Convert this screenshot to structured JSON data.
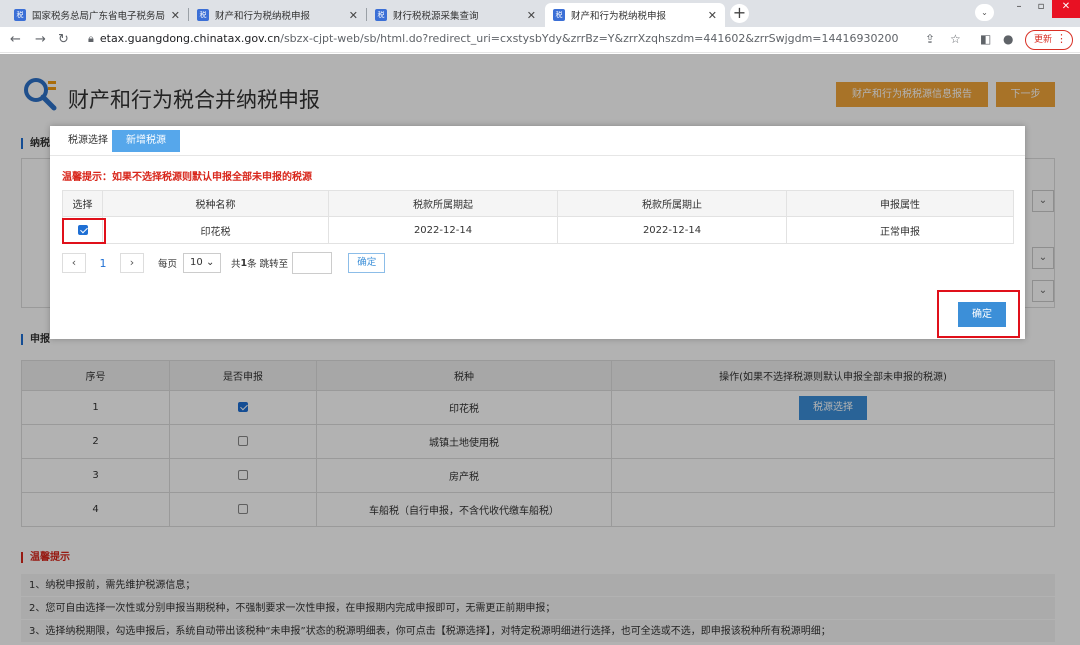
{
  "browser": {
    "tabs": [
      {
        "label": "国家税务总局广东省电子税务局",
        "favicon": "税"
      },
      {
        "label": "财产和行为税纳税申报",
        "favicon": "税"
      },
      {
        "label": "财行税税源采集查询",
        "favicon": "税"
      },
      {
        "label": "财产和行为税纳税申报",
        "favicon": "税"
      }
    ],
    "url_host": "etax.guangdong.chinatax.gov.cn",
    "url_path": "/sbzx-cjpt-web/sb/html.do?redirect_uri=cxstysbYdy&zrrBz=Y&zrrXzqhszdm=441602&zrrSwjgdm=14416930200",
    "update_label": "更新"
  },
  "page": {
    "title": "财产和行为税合并纳税申报",
    "report_button": "财产和行为税税源信息报告",
    "next_button": "下一步",
    "section_taxpayer": "纳税",
    "section_declare": "申报",
    "declare_table": {
      "headers": [
        "序号",
        "是否申报",
        "税种",
        "操作(如果不选择税源则默认申报全部未申报的税源)"
      ],
      "rows": [
        {
          "no": "1",
          "checked": true,
          "tax": "印花税",
          "action": "税源选择"
        },
        {
          "no": "2",
          "checked": false,
          "tax": "城镇土地使用税",
          "action": ""
        },
        {
          "no": "3",
          "checked": false,
          "tax": "房产税",
          "action": ""
        },
        {
          "no": "4",
          "checked": false,
          "tax": "车船税（自行申报，不含代收代缴车船税）",
          "action": ""
        }
      ]
    },
    "tips_title": "温馨提示",
    "tips": [
      "1、纳税申报前，需先维护税源信息；",
      "2、您可自由选择一次性或分别申报当期税种，不强制要求一次性申报，在申报期内完成申报即可，无需更正前期申报；",
      "3、选择纳税期限，勾选申报后，系统自动带出该税种“未申报”状态的税源明细表，你可点击【税源选择】，对特定税源明细进行选择，也可全选或不选，即申报该税种所有税源明细；"
    ]
  },
  "modal": {
    "tab_selected": "税源选择",
    "tab_new": "新增税源",
    "tip": "温馨提示：如果不选择税源则默认申报全部未申报的税源",
    "headers": [
      "选择",
      "税种名称",
      "税款所属期起",
      "税款所属期止",
      "申报属性"
    ],
    "rows": [
      {
        "checked": true,
        "name": "印花税",
        "start": "2022-12-14",
        "end": "2022-12-14",
        "attr": "正常申报"
      }
    ],
    "pager": {
      "current_page": "1",
      "per_page_label": "每页",
      "per_page": "10",
      "total_prefix": "共",
      "total": "1",
      "total_suffix": "条 跳转至",
      "go_label": "确定"
    },
    "confirm": "确定"
  }
}
